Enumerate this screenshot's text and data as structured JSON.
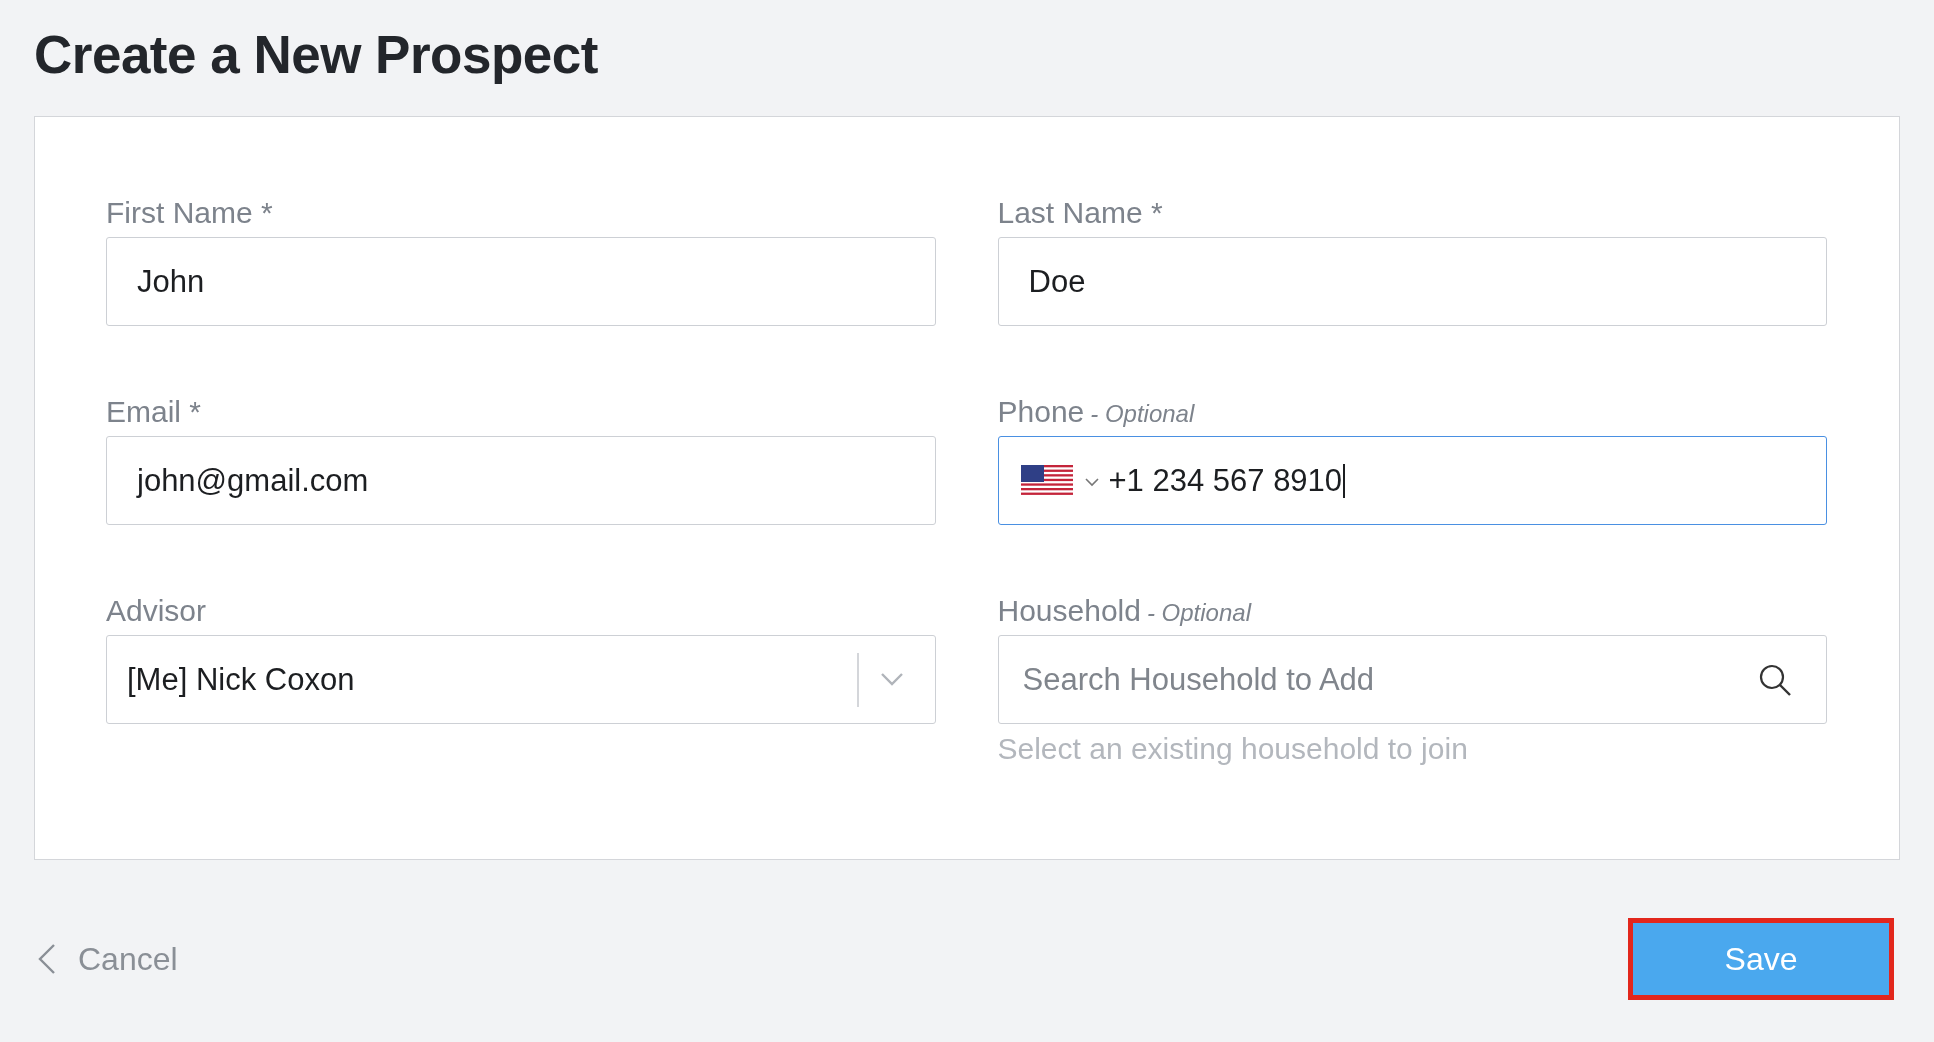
{
  "page": {
    "title": "Create a New Prospect"
  },
  "fields": [
    {
      "kind": "text",
      "label": "First Name *",
      "value": "John",
      "focused": false
    },
    {
      "kind": "text",
      "label": "Last Name *",
      "value": "Doe",
      "focused": false
    },
    {
      "kind": "text",
      "label": "Email *",
      "value": "john@gmail.com",
      "focused": false
    },
    {
      "kind": "phone",
      "label": "Phone",
      "optional": "- Optional",
      "value": "+1 234 567 8910",
      "focused": true
    },
    {
      "kind": "select",
      "label": "Advisor",
      "value": "[Me] Nick Coxon",
      "focused": false
    },
    {
      "kind": "search",
      "label": "Household",
      "optional": "- Optional",
      "placeholder": "Search Household to Add",
      "help": "Select an existing household to join",
      "focused": false
    }
  ],
  "footer": {
    "cancel": "Cancel",
    "save": {
      "label": "Save",
      "highlighted": true
    }
  }
}
